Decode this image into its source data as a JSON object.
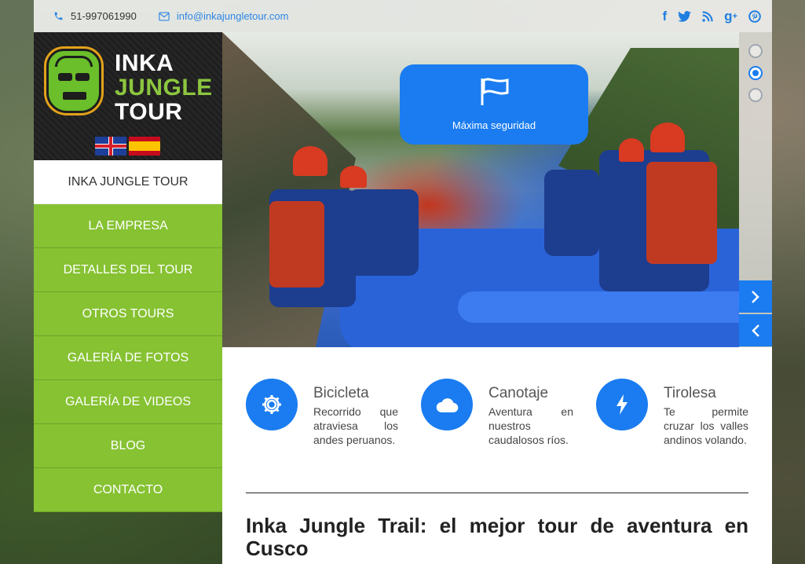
{
  "topbar": {
    "phone": "51-997061990",
    "email": "info@inkajungletour.com",
    "social": [
      "facebook",
      "twitter",
      "rss",
      "google-plus",
      "pinterest"
    ]
  },
  "logo": {
    "line1": "INKA",
    "line2": "JUNGLE",
    "line3": "TOUR"
  },
  "languages": [
    "English",
    "Español"
  ],
  "menu": [
    "INKA JUNGLE TOUR",
    "LA EMPRESA",
    "DETALLES DEL TOUR",
    "OTROS TOURS",
    "GALERÍA DE FOTOS",
    "GALERÍA DE VIDEOS",
    "BLOG",
    "CONTACTO"
  ],
  "hero": {
    "card_title": "Máxima seguridad",
    "slides": 3,
    "active_slide": 2
  },
  "features": [
    {
      "name": "Bicicleta",
      "desc": "Recorrido que atraviesa los andes peruanos.",
      "icon": "gear-icon"
    },
    {
      "name": "Canotaje",
      "desc": "Aventura en nuestros caudalosos ríos.",
      "icon": "cloud-icon"
    },
    {
      "name": "Tirolesa",
      "desc": "Te permite cruzar los valles andinos volando.",
      "icon": "bolt-icon"
    }
  ],
  "headline": "Inka Jungle Trail: el mejor tour de aventura en Cusco",
  "colors": {
    "accent": "#1a7cf0",
    "green": "#86c232",
    "dark": "#222222"
  }
}
